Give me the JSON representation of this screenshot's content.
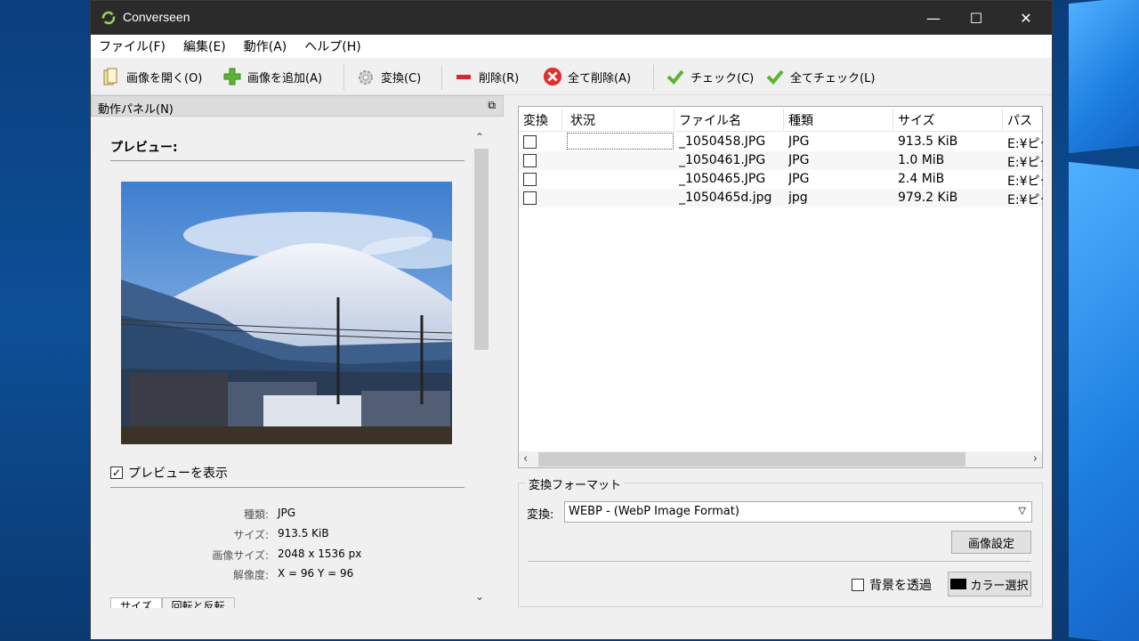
{
  "window": {
    "title": "Converseen"
  },
  "menu": [
    "ファイル(F)",
    "編集(E)",
    "動作(A)",
    "ヘルプ(H)"
  ],
  "toolbar": {
    "open": "画像を開く(O)",
    "add": "画像を追加(A)",
    "convert": "変換(C)",
    "delete": "削除(R)",
    "delete_all": "全て削除(A)",
    "check": "チェック(C)",
    "check_all": "全てチェック(L)"
  },
  "panel": {
    "title": "動作パネル(N)",
    "preview_label": "プレビュー:",
    "show_preview_label": "プレビューを表示",
    "show_preview_checked": true,
    "info": [
      {
        "key": "種類:",
        "value": "JPG"
      },
      {
        "key": "サイズ:",
        "value": "913.5 KiB"
      },
      {
        "key": "画像サイズ:",
        "value": "2048 x 1536 px"
      },
      {
        "key": "解像度:",
        "value": "X = 96 Y = 96"
      }
    ],
    "tabs": [
      "サイズ",
      "回転と反転"
    ]
  },
  "filelist": {
    "columns": [
      "変換",
      "状況",
      "ファイル名",
      "種類",
      "サイズ",
      "パス"
    ],
    "rows": [
      {
        "status": "",
        "name": "_1050458.JPG",
        "type": "JPG",
        "size": "913.5 KiB",
        "path": "E:¥ピク"
      },
      {
        "status": "",
        "name": "_1050461.JPG",
        "type": "JPG",
        "size": "1.0 MiB",
        "path": "E:¥ピク"
      },
      {
        "status": "",
        "name": "_1050465.JPG",
        "type": "JPG",
        "size": "2.4 MiB",
        "path": "E:¥ピク"
      },
      {
        "status": "",
        "name": "_1050465d.jpg",
        "type": "jpg",
        "size": "979.2 KiB",
        "path": "E:¥ピク"
      }
    ]
  },
  "format": {
    "group_title": "変換フォーマット",
    "label": "変換:",
    "selected": "WEBP - (WebP Image Format)",
    "image_settings": "画像設定",
    "transparent_bg": "背景を透過",
    "color_select": "カラー選択"
  }
}
